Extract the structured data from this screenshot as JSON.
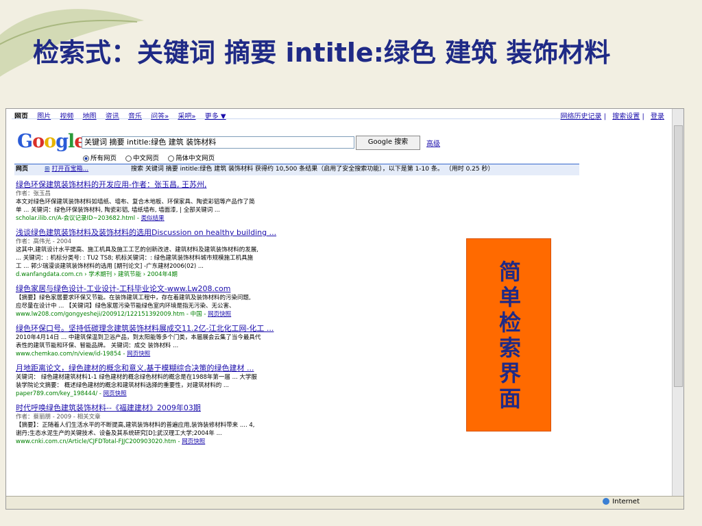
{
  "slide": {
    "title": "检索式：关键词 摘要 intitle:绿色 建筑 装饰材料",
    "callout": "简单检索界面"
  },
  "browser": {
    "nav": [
      "网页",
      "图片",
      "视频",
      "地图",
      "资讯",
      "音乐",
      "问答»",
      "采吧»",
      "更多 ▼"
    ],
    "top_right": [
      "网络历史记录",
      "搜索设置",
      "登录"
    ],
    "logo": "Google",
    "search": {
      "value": "关键词  摘要  intitle:绿色  建筑  装饰材料",
      "button": "Google 搜索",
      "advanced": "高级"
    },
    "radios": [
      {
        "label": "所有网页",
        "selected": true
      },
      {
        "label": "中文网页",
        "selected": false
      },
      {
        "label": "简体中文网页",
        "selected": false
      }
    ],
    "result_bar": {
      "left": "网页",
      "open": "打开百宝箱...",
      "stats": "搜索 关键词 摘要 intitle:绿色 建筑 装饰材料 获得约 10,500 条结果（启用了安全搜索功能），以下是第 1-10 条。 （用时 0.25 秒）"
    },
    "status": {
      "zone": "Internet"
    }
  },
  "results": [
    {
      "title": "绿色环保建筑装饰材料的开发应用-作者：张玉昌, 王苏州,",
      "meta": "作者：张玉昌",
      "snippet1": "本文对绿色环保建筑装饰材料如墙纸、墙布、复合木地板、环保家具、陶瓷彩铝等产品作了简",
      "snippet2": "单 ... 关键词：绿色环保装饰材料, 陶瓷彩铝, 墙纸墙布, 墙面漆, | 全部关键词 ...",
      "url": "scholar.ilib.cn/A-会议记录ID~203682.html",
      "cache": "类似结果"
    },
    {
      "title": "浅谈绿色建筑装饰材料及装饰材料的选用Discussion on healthy building ...",
      "meta": "作者：高伟光 - 2004",
      "snippet1": "这其中,建筑设计水平提高、施工机具及施工工艺的创新改进、建筑材料及建筑装饰材料的发展,",
      "snippet2": "... 关键词：: 机标分类号: : TU2 TS8; 机标关键词：: 绿色建筑装饰材料城市规模施工机具施",
      "snippet3": "工 ... 郭少瑞漫谈建筑装饰材料的选用 [期刊论文] -广东建材2006(02) ...",
      "url": "d.wanfangdata.com.cn › 学术期刊 › 建筑节能 › 2004年4期",
      "cache": ""
    },
    {
      "title": "绿色家居与绿色设计-工业设计-工科毕业论文-www.Lw208.com",
      "meta": "",
      "snippet1": "【摘要】绿色家居要求环保又节能。在装饰建筑工程中，存在着建筑及装饰材料的污染问题,",
      "snippet2": "应尽量在设计中 ... 【关键词】绿色家居污染节能绿色室内环境是指无污染、无公害、",
      "url": "www.lw208.com/gongyesheji/200912/122151392009.htm - 中国 -",
      "cache": "网页快照"
    },
    {
      "title": "绿色环保口号。坚持低碳理念建筑装饰材料展成交11.2亿-江北化工网-化工 ...",
      "meta": "",
      "snippet1": "2010年4月14日 ... 中建筑保温到卫浴产品，到太阳能等多个门类，本届展会云集了当今最具代",
      "snippet2": "表性的建筑节能和环保、智能品牌。 关键词：成交 装饰材料 ...",
      "url": "www.chemkao.com/n/view/id-19854 -",
      "cache": "网页快照"
    },
    {
      "title": "月地距离论文，绿色建材的概念和意义,基于模糊综合决策的绿色建材 ...",
      "meta": "",
      "snippet1": "关键词：  绿色建材建筑材料1-1 绿色建材的概念绿色材料的概念是在1988年第一届 ... 大学服",
      "snippet2": "装学院论文摘要：  概述绿色建材的概念和建筑材料选择的重要性，对建筑材料的 ...",
      "url": "paper789.com/key_198444/ -",
      "cache": "网页快照"
    },
    {
      "title": "时代呼唤绿色建筑装饰材料--《福建建材》2009年03期",
      "meta": "作者：蔡丽朋 - 2009 - 相关文章",
      "snippet1": "【摘要】：正随着人们生活水平的不断提高,建筑装饰材料的普遍应用,装饰装修材料带来 .... 4,",
      "snippet2": "谢丹;生态水泥生产的关键技术、设备及其系统研究[D];武汉理工大学;2004年 ...",
      "url": "www.cnki.com.cn/Article/CJFDTotal-FJJC200903020.htm -",
      "cache": "网页快照"
    }
  ]
}
